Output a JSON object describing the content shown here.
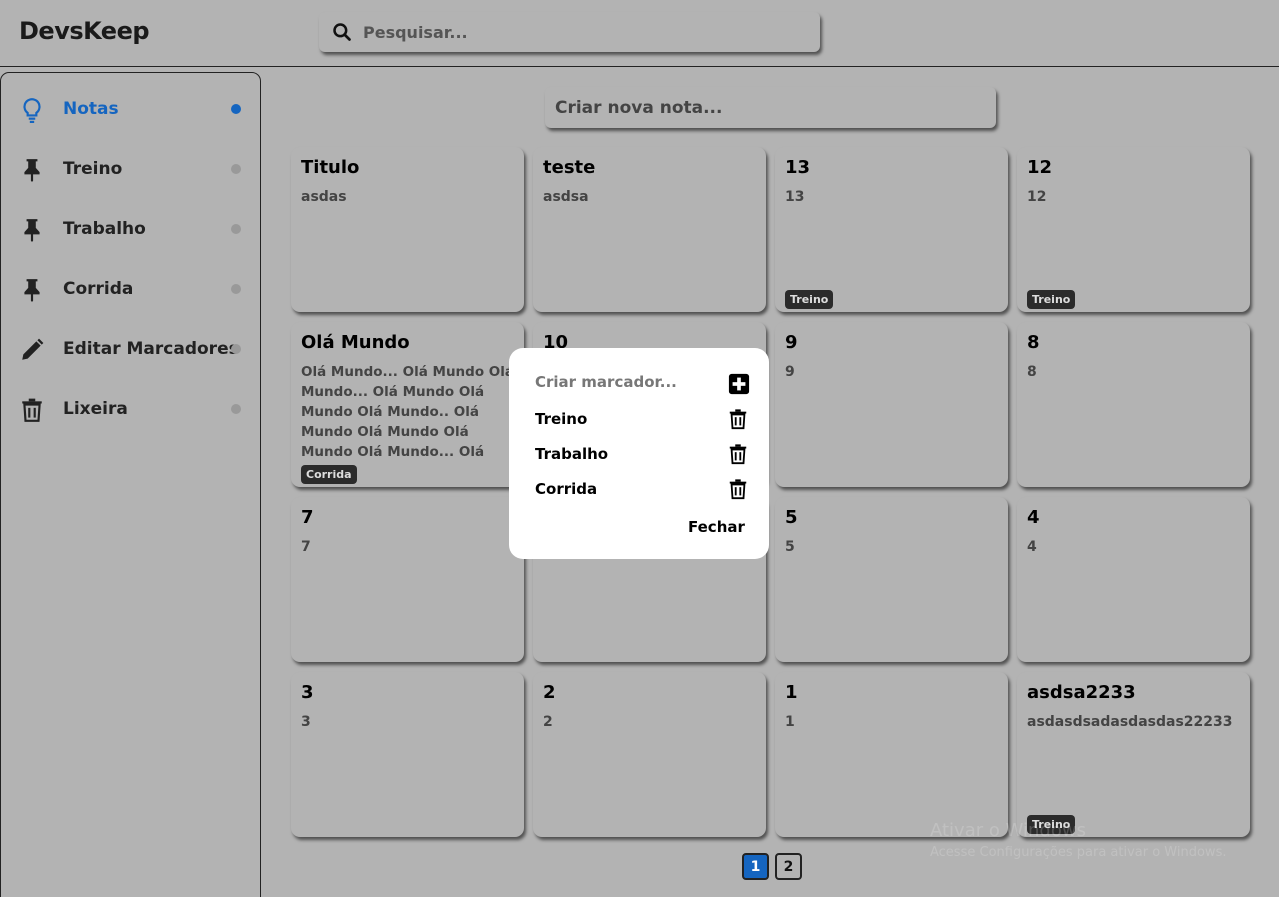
{
  "app": {
    "title": "DevsKeep"
  },
  "search": {
    "placeholder": "Pesquisar..."
  },
  "sidebar": {
    "items": [
      {
        "label": "Notas",
        "icon": "lightbulb-icon",
        "active": true
      },
      {
        "label": "Treino",
        "icon": "pin-icon"
      },
      {
        "label": "Trabalho",
        "icon": "pin-icon"
      },
      {
        "label": "Corrida",
        "icon": "pin-icon"
      },
      {
        "label": "Editar Marcadores",
        "icon": "pencil-icon"
      },
      {
        "label": "Lixeira",
        "icon": "trash-icon"
      }
    ]
  },
  "new_note": {
    "placeholder": "Criar nova nota..."
  },
  "notes": [
    {
      "title": "Titulo",
      "body": "asdas",
      "tag": ""
    },
    {
      "title": "teste",
      "body": "asdsa",
      "tag": ""
    },
    {
      "title": "13",
      "body": "13",
      "tag": "Treino"
    },
    {
      "title": "12",
      "body": "12",
      "tag": "Treino"
    },
    {
      "title": "Olá Mundo",
      "body": "Olá Mundo... Olá Mundo Olá Mundo... Olá Mundo Olá Mundo Olá Mundo.. Olá Mundo Olá Mundo Olá Mundo Olá Mundo... Olá",
      "tag": "Corrida"
    },
    {
      "title": "10",
      "body": "",
      "tag": ""
    },
    {
      "title": "9",
      "body": "9",
      "tag": ""
    },
    {
      "title": "8",
      "body": "8",
      "tag": ""
    },
    {
      "title": "7",
      "body": "7",
      "tag": ""
    },
    {
      "title": "",
      "body": "",
      "tag": ""
    },
    {
      "title": "5",
      "body": "5",
      "tag": ""
    },
    {
      "title": "4",
      "body": "4",
      "tag": ""
    },
    {
      "title": "3",
      "body": "3",
      "tag": ""
    },
    {
      "title": "2",
      "body": "2",
      "tag": ""
    },
    {
      "title": "1",
      "body": "1",
      "tag": ""
    },
    {
      "title": "asdsa2233",
      "body": "asdasdsadasdasdas22233",
      "tag": "Treino"
    }
  ],
  "pagination": {
    "pages": [
      "1",
      "2"
    ],
    "current": "1"
  },
  "modal": {
    "create_placeholder": "Criar marcador...",
    "markers": [
      "Treino",
      "Trabalho",
      "Corrida"
    ],
    "close_label": "Fechar"
  },
  "watermark": {
    "line1": "Ativar o Windows",
    "line2": "Acesse Configurações para ativar o Windows."
  },
  "colors": {
    "accent": "#1565c0",
    "background": "#b3b3b3",
    "tag": "#2b2b2b"
  }
}
